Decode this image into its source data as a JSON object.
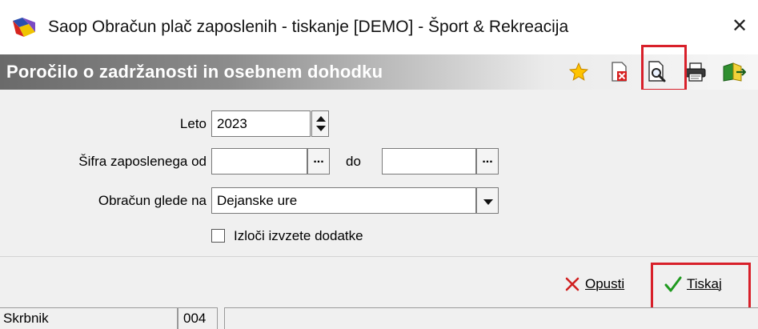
{
  "window": {
    "title": "Saop Obračun plač zaposlenih -  tiskanje [DEMO] - Šport & Rekreacija",
    "close_label": "✕"
  },
  "header": {
    "title": "Poročilo o zadržanosti in osebnem dohodku"
  },
  "toolbar": {
    "icons": [
      "star-icon",
      "delete-report-icon",
      "print-preview-icon",
      "printer-icon",
      "export-icon"
    ],
    "highlighted": "print-preview-icon"
  },
  "form": {
    "leto_label": "Leto",
    "leto_value": "2023",
    "sifra_label": "Šifra zaposlenega od",
    "sifra_od_value": "",
    "sifra_do_label": "do",
    "sifra_do_value": "",
    "ellipsis_label": "...",
    "obracun_label": "Obračun glede na",
    "obracun_value": "Dejanske ure",
    "izloci_label": "Izloči izvzete dodatke",
    "izloci_checked": false
  },
  "actions": {
    "opusti_label": "Opusti",
    "tiskaj_label": "Tiskaj"
  },
  "status": {
    "user": "Skrbnik",
    "code": "004",
    "message": ""
  },
  "colors": {
    "highlight": "#d8202a",
    "cancel": "#d02020",
    "confirm": "#1f9a1f"
  }
}
